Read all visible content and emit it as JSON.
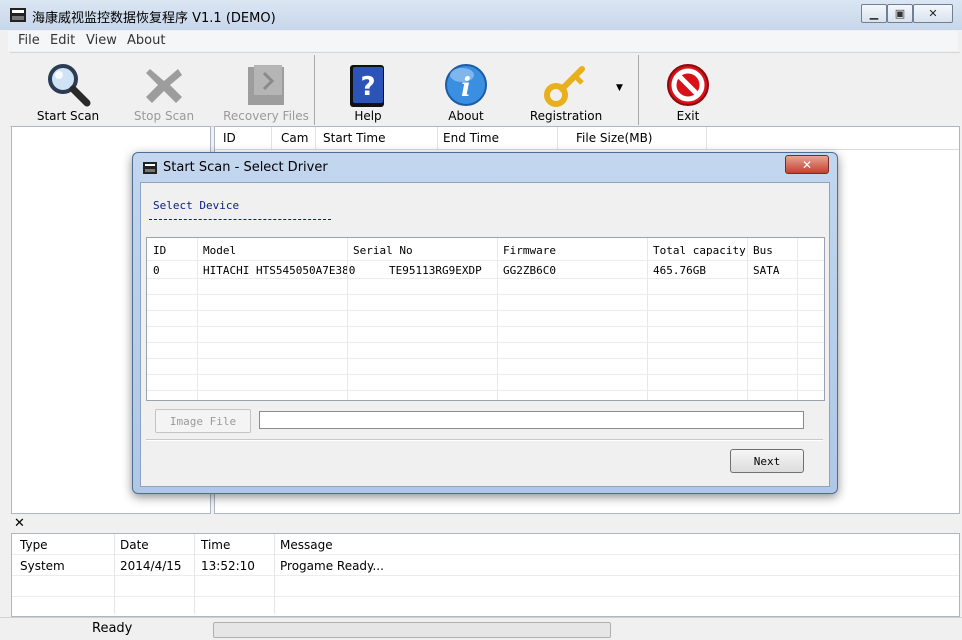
{
  "window": {
    "title": "海康威视监控数据恢复程序 V1.1 (DEMO)"
  },
  "menu": [
    "File",
    "Edit",
    "View",
    "About"
  ],
  "toolbar": {
    "start_scan": "Start Scan",
    "stop_scan": "Stop Scan",
    "recovery_files": "Recovery Files",
    "help": "Help",
    "about": "About",
    "registration": "Registration",
    "exit": "Exit"
  },
  "results": {
    "columns": [
      "ID",
      "Cam",
      "Start Time",
      "End Time",
      "File Size(MB)"
    ]
  },
  "dialog": {
    "title": "Start Scan - Select Driver",
    "section": "Select Device",
    "columns": [
      "ID",
      "Model",
      "Serial No",
      "Firmware",
      "Total capacity",
      "Bus"
    ],
    "rows": [
      {
        "id": "0",
        "model": "HITACHI HTS545050A7E380",
        "serial": "TE95113RG9EXDP",
        "firmware": "GG2ZB6C0",
        "capacity": "465.76GB",
        "bus": "SATA"
      }
    ],
    "image_file_btn": "Image File",
    "image_path": "",
    "next_btn": "Next"
  },
  "log": {
    "columns": [
      "Type",
      "Date",
      "Time",
      "Message"
    ],
    "rows": [
      {
        "type": "System",
        "date": "2014/4/15",
        "time": "13:52:10",
        "message": "Progame Ready..."
      }
    ]
  },
  "status": {
    "text": "Ready",
    "progress": 0
  },
  "colors": {
    "titlebar": "#c7d6ea",
    "dialog_frame": "#aec8e6",
    "accent": "#0a1f7c"
  }
}
